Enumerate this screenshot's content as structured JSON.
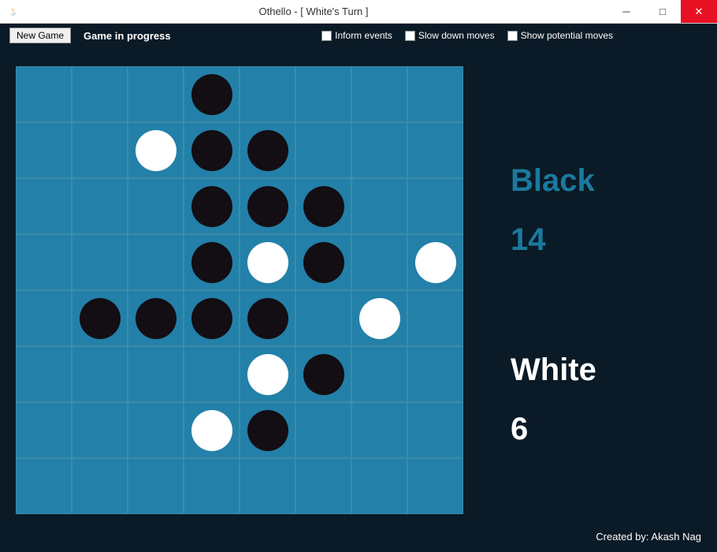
{
  "window": {
    "title": "Othello - [ White's Turn ]"
  },
  "toolbar": {
    "new_game_label": "New Game",
    "status": "Game in progress",
    "checkboxes": [
      {
        "label": "Inform events",
        "checked": false
      },
      {
        "label": "Slow down moves",
        "checked": false
      },
      {
        "label": "Show potential moves",
        "checked": false
      }
    ]
  },
  "board": {
    "grid": [
      [
        0,
        0,
        0,
        1,
        0,
        0,
        0,
        0
      ],
      [
        0,
        0,
        2,
        1,
        1,
        0,
        0,
        0
      ],
      [
        0,
        0,
        0,
        1,
        1,
        1,
        0,
        0
      ],
      [
        0,
        0,
        0,
        1,
        2,
        1,
        0,
        2
      ],
      [
        0,
        1,
        1,
        1,
        1,
        0,
        2,
        0
      ],
      [
        0,
        0,
        0,
        0,
        2,
        1,
        0,
        0
      ],
      [
        0,
        0,
        0,
        2,
        1,
        0,
        0,
        0
      ],
      [
        0,
        0,
        0,
        0,
        0,
        0,
        0,
        0
      ]
    ],
    "stars": [
      {
        "row": 2,
        "col": 2
      },
      {
        "row": 2,
        "col": 6
      },
      {
        "row": 6,
        "col": 2
      },
      {
        "row": 6,
        "col": 6
      }
    ]
  },
  "scores": {
    "black": {
      "label": "Black",
      "value": "14"
    },
    "white": {
      "label": "White",
      "value": "6"
    }
  },
  "credits": "Created by: Akash Nag"
}
